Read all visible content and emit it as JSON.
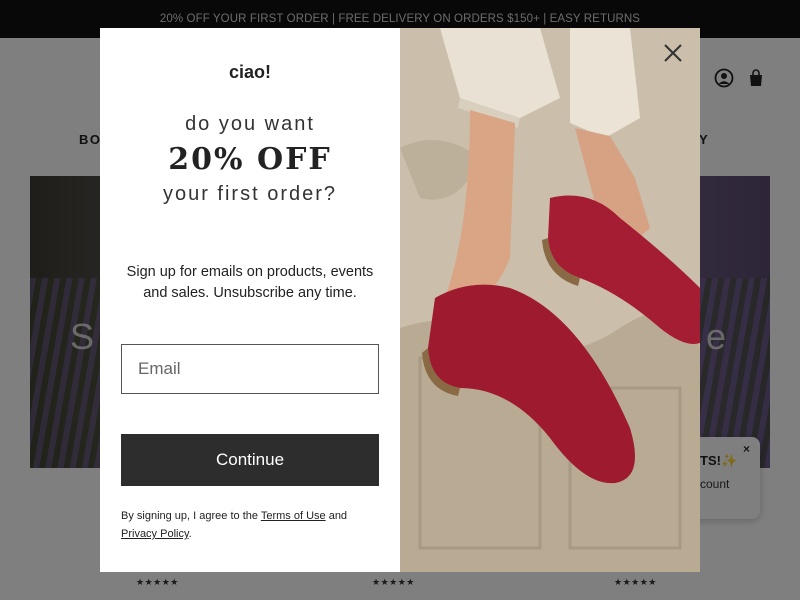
{
  "announcement": "20% OFF YOUR FIRST ORDER | FREE DELIVERY ON ORDERS $150+ | EASY RETURNS",
  "background": {
    "nav_left_partial": "BO",
    "nav_right_partial": "Y",
    "hero_left_partial": "S",
    "hero_right_partial": "e",
    "reward_title_partial": "TS!✨",
    "reward_sub_partial": "count",
    "reward_close": "×",
    "stars": "★★★★★"
  },
  "popup": {
    "brand": "ciao!",
    "headline_top": "do you want",
    "headline_offer": "20% OFF",
    "headline_bottom": "your first order?",
    "description": "Sign up for emails on products, events and sales. Unsubscribe any time.",
    "email_placeholder": "Email",
    "continue_label": "Continue",
    "legal_prefix": "By signing up, I agree to the ",
    "terms_label": "Terms of Use",
    "legal_and": " and ",
    "privacy_label": "Privacy Policy",
    "legal_suffix": "."
  },
  "icons": {
    "close": "close-icon",
    "search": "search-icon",
    "account": "account-icon",
    "cart": "cart-icon"
  },
  "colors": {
    "announcement_bg": "#111111",
    "button_bg": "#2d2d2d",
    "shoe_red": "#9e1a2e"
  }
}
